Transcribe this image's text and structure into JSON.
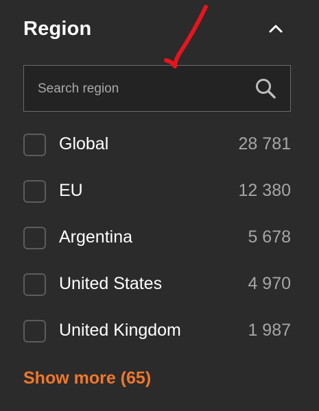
{
  "filter": {
    "title": "Region",
    "collapse_icon": "chevron-up-icon",
    "search": {
      "placeholder": "Search region",
      "value": "",
      "icon": "search-icon"
    },
    "items": [
      {
        "label": "Global",
        "count": "28 781",
        "checked": false
      },
      {
        "label": "EU",
        "count": "12 380",
        "checked": false
      },
      {
        "label": "Argentina",
        "count": "5 678",
        "checked": false
      },
      {
        "label": "United States",
        "count": "4 970",
        "checked": false
      },
      {
        "label": "United Kingdom",
        "count": "1 987",
        "checked": false
      }
    ],
    "show_more_label": "Show more (65)"
  },
  "colors": {
    "background": "#2b2b2b",
    "accent": "#f0782a",
    "annotation": "#e8141e"
  }
}
